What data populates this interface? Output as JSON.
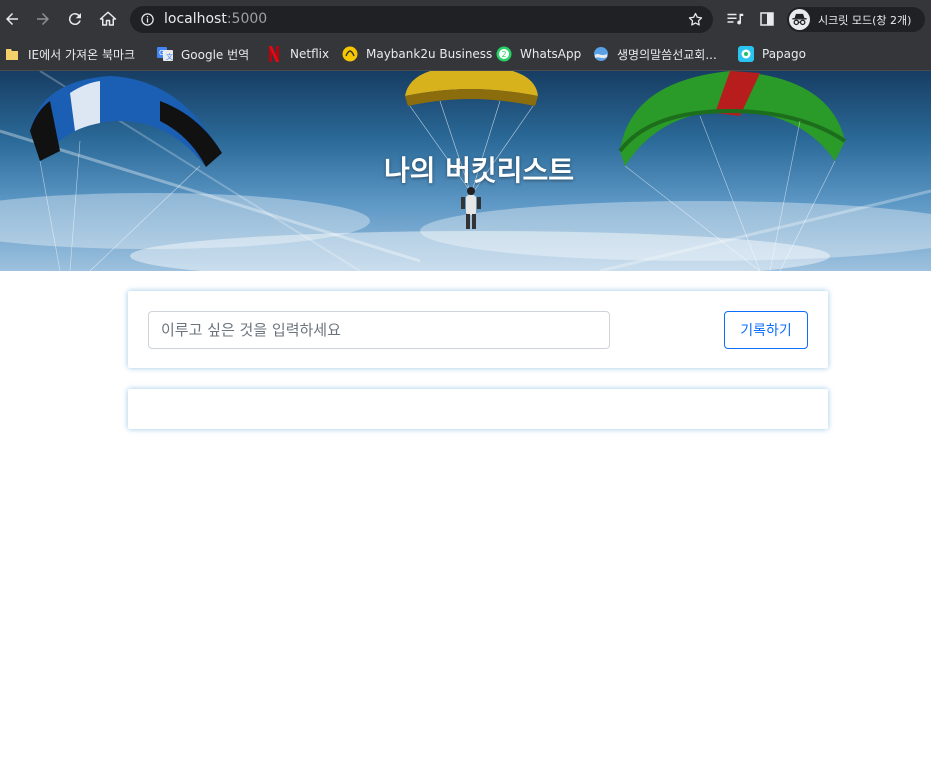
{
  "browser": {
    "url_host": "localhost",
    "url_port": ":5000",
    "profile_label": "시크릿 모드(창 2개)",
    "bookmarks": [
      {
        "label": "IE에서 가져온 북마크",
        "icon": "folder-icon"
      },
      {
        "label": "Google 번역",
        "icon": "google-translate-icon"
      },
      {
        "label": "Netflix",
        "icon": "netflix-icon"
      },
      {
        "label": "Maybank2u Business",
        "icon": "maybank-icon"
      },
      {
        "label": "WhatsApp",
        "icon": "whatsapp-icon"
      },
      {
        "label": "생명의말씀선교회...",
        "icon": "globe-icon"
      },
      {
        "label": "Papago",
        "icon": "papago-icon"
      }
    ]
  },
  "page": {
    "title": "나의 버킷리스트",
    "input_placeholder": "이루고 싶은 것을 입력하세요",
    "input_value": "",
    "save_label": "기록하기",
    "bucket_items": []
  },
  "colors": {
    "chrome_bg": "#35363a",
    "omnibox_bg": "#202124",
    "accent": "#0d6efd",
    "card_shadow": "#78b4e1"
  }
}
